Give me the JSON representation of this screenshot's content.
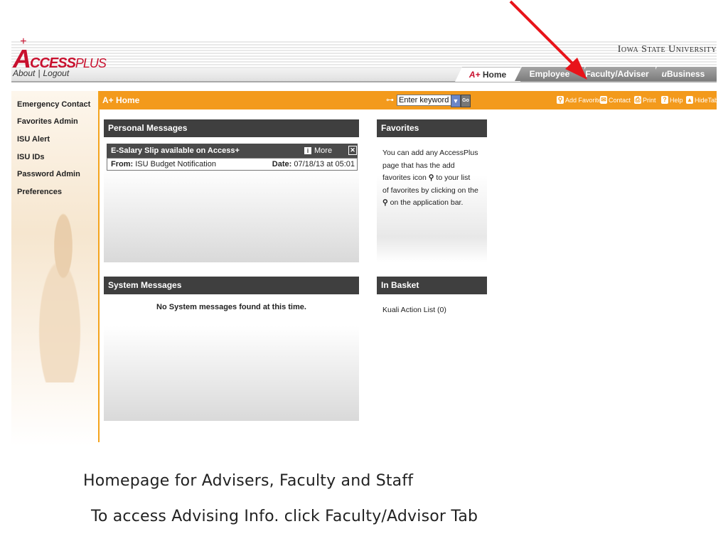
{
  "logo": {
    "text_big": "A",
    "text_mid": "CCESS",
    "text_small": "PLUS",
    "plus": "+"
  },
  "header": {
    "about": "About",
    "separator": "|",
    "logout": "Logout",
    "university": "Iowa State University"
  },
  "tabs": [
    {
      "prefix": "A+",
      "label": "Home",
      "active": true
    },
    {
      "label": "Employee",
      "active": false
    },
    {
      "label": "Faculty/Adviser",
      "active": false
    },
    {
      "prefix": "u",
      "label": "Business",
      "active": false
    }
  ],
  "sidebar": {
    "items": [
      "Emergency Contact",
      "Favorites Admin",
      "ISU Alert",
      "ISU IDs",
      "Password Admin",
      "Preferences"
    ]
  },
  "toolbar": {
    "title": "A+ Home",
    "search_value": "Enter keyword",
    "go_label": "Go",
    "add_favorite": "Add Favorite",
    "contact": "Contact",
    "print": "Print",
    "help": "Help",
    "hide_tabs": "HideTabs"
  },
  "personal_messages": {
    "title": "Personal Messages",
    "message": {
      "subject": "E-Salary Slip available on Access+",
      "more": "More",
      "from_label": "From:",
      "from": "ISU Budget Notification",
      "date_label": "Date:",
      "date": "07/18/13 at 05:01"
    }
  },
  "favorites": {
    "title": "Favorites",
    "line1": "You can add any AccessPlus",
    "line2": "page that has the add",
    "line3a": "favorites icon",
    "line3b": "to your list",
    "line4": "of favorites by clicking on the",
    "line5": "on the application bar."
  },
  "system_messages": {
    "title": "System Messages",
    "empty": "No System messages found at this time."
  },
  "in_basket": {
    "title": "In Basket",
    "item": "Kuali Action List (0)"
  },
  "captions": {
    "line1": "Homepage for Advisers, Faculty and Staff",
    "line2": "To access Advising Info. click Faculty/Advisor Tab"
  },
  "colors": {
    "orange": "#f39a1c",
    "brand_red": "#c8102e",
    "panel_head": "#3f3f3f",
    "arrow": "#e8141a"
  }
}
